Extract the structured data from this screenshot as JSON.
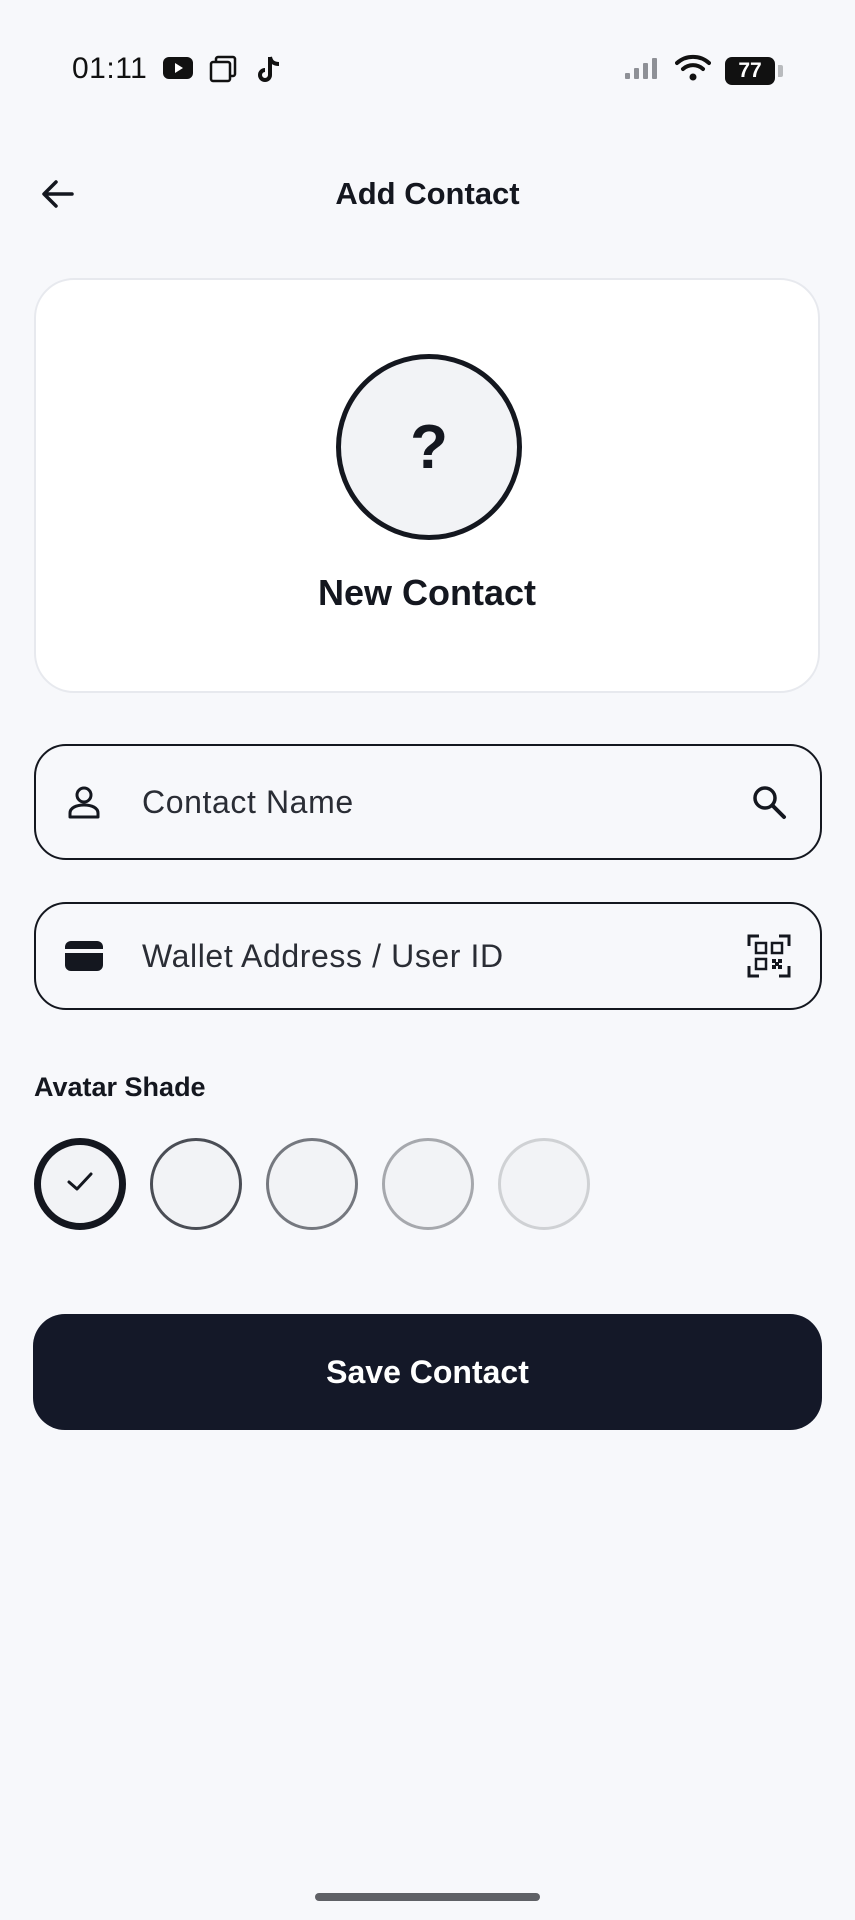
{
  "status_bar": {
    "time": "01:11",
    "app_icons": [
      "youtube-icon",
      "layers-icon",
      "tiktok-icon"
    ],
    "battery_level": "77"
  },
  "header": {
    "title": "Add Contact",
    "back_icon": "arrow-left-icon"
  },
  "preview": {
    "avatar_glyph": "?",
    "name": "New Contact"
  },
  "form": {
    "name_field": {
      "placeholder": "Contact Name",
      "value": "",
      "lead_icon": "person-icon",
      "trail_icon": "search-icon"
    },
    "wallet_field": {
      "placeholder": "Wallet Address / User ID",
      "value": "",
      "lead_icon": "wallet-icon",
      "trail_icon": "qr-scan-icon"
    }
  },
  "avatar_shade": {
    "label": "Avatar Shade",
    "shades": [
      {
        "color": "#14171f",
        "selected": true
      },
      {
        "color": "#4a4d55",
        "selected": false
      },
      {
        "color": "#75787f",
        "selected": false
      },
      {
        "color": "#a6a8ad",
        "selected": false
      },
      {
        "color": "#cfd1d4",
        "selected": false
      }
    ]
  },
  "actions": {
    "save_label": "Save Contact"
  },
  "colors": {
    "background": "#f7f8fb",
    "primary": "#141828",
    "text": "#14171f"
  }
}
